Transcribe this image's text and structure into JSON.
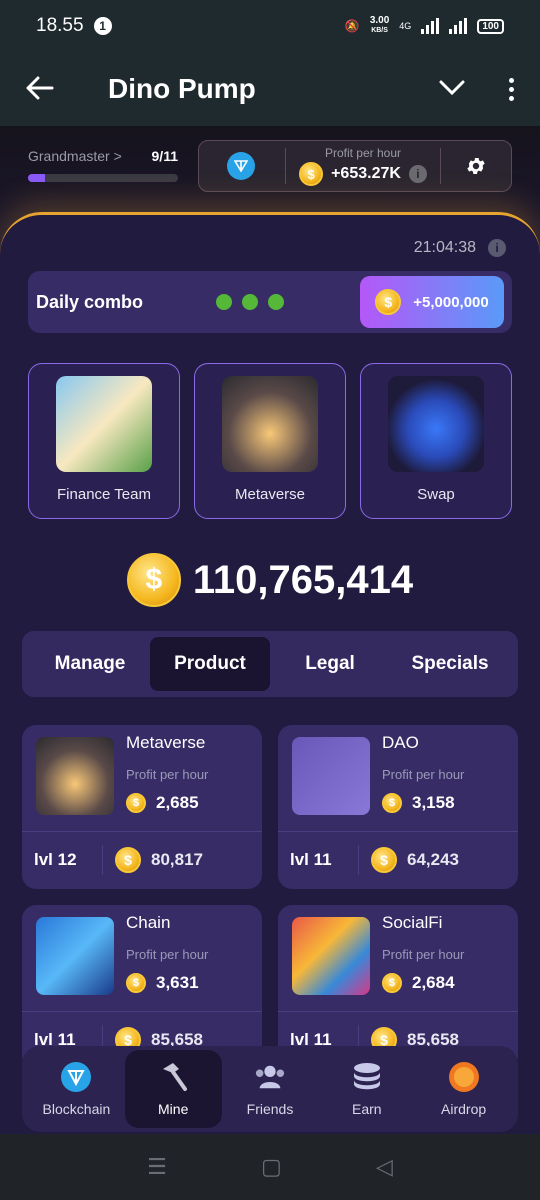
{
  "status_bar": {
    "time": "18.55",
    "notif_count": "1",
    "net_speed_top": "3.00",
    "net_speed_unit": "KB/S",
    "network": "4G",
    "battery": "100"
  },
  "app_bar": {
    "title": "Dino Pump"
  },
  "rank": {
    "label": "Grandmaster >",
    "level": "9/11",
    "progress": 0.11
  },
  "profit": {
    "label": "Profit per hour",
    "value": "+653.27K",
    "ton_icon": "ton-icon",
    "info_icon": "i",
    "settings_icon": "gear-icon"
  },
  "timer": "21:04:38",
  "daily_combo": {
    "label": "Daily combo",
    "reward": "+5,000,000"
  },
  "combo_cards": [
    {
      "name": "Finance Team"
    },
    {
      "name": "Metaverse"
    },
    {
      "name": "Swap"
    }
  ],
  "balance": "110,765,414",
  "tabs": [
    {
      "label": "Manage"
    },
    {
      "label": "Product"
    },
    {
      "label": "Legal"
    },
    {
      "label": "Specials"
    }
  ],
  "cards": [
    {
      "title": "Metaverse",
      "sub": "Profit per hour",
      "profit": "2,685",
      "lvl": "lvl 12",
      "price": "80,817"
    },
    {
      "title": "DAO",
      "sub": "Profit per hour",
      "profit": "3,158",
      "lvl": "lvl 11",
      "price": "64,243"
    },
    {
      "title": "Chain",
      "sub": "Profit per hour",
      "profit": "3,631",
      "lvl": "lvl 11",
      "price": "85,658"
    },
    {
      "title": "SocialFi",
      "sub": "Profit per hour",
      "profit": "2,684",
      "lvl": "lvl 11",
      "price": "85,658"
    }
  ],
  "bottom_nav": [
    {
      "label": "Blockchain",
      "icon": "ton-icon"
    },
    {
      "label": "Mine",
      "icon": "hammer-icon"
    },
    {
      "label": "Friends",
      "icon": "friends-icon"
    },
    {
      "label": "Earn",
      "icon": "coins-stack-icon"
    },
    {
      "label": "Airdrop",
      "icon": "airdrop-coin-icon"
    }
  ],
  "colors": {
    "accent": "#8a5af8",
    "panel": "#221b40",
    "gold": "#f5b820",
    "green": "#56b838"
  }
}
